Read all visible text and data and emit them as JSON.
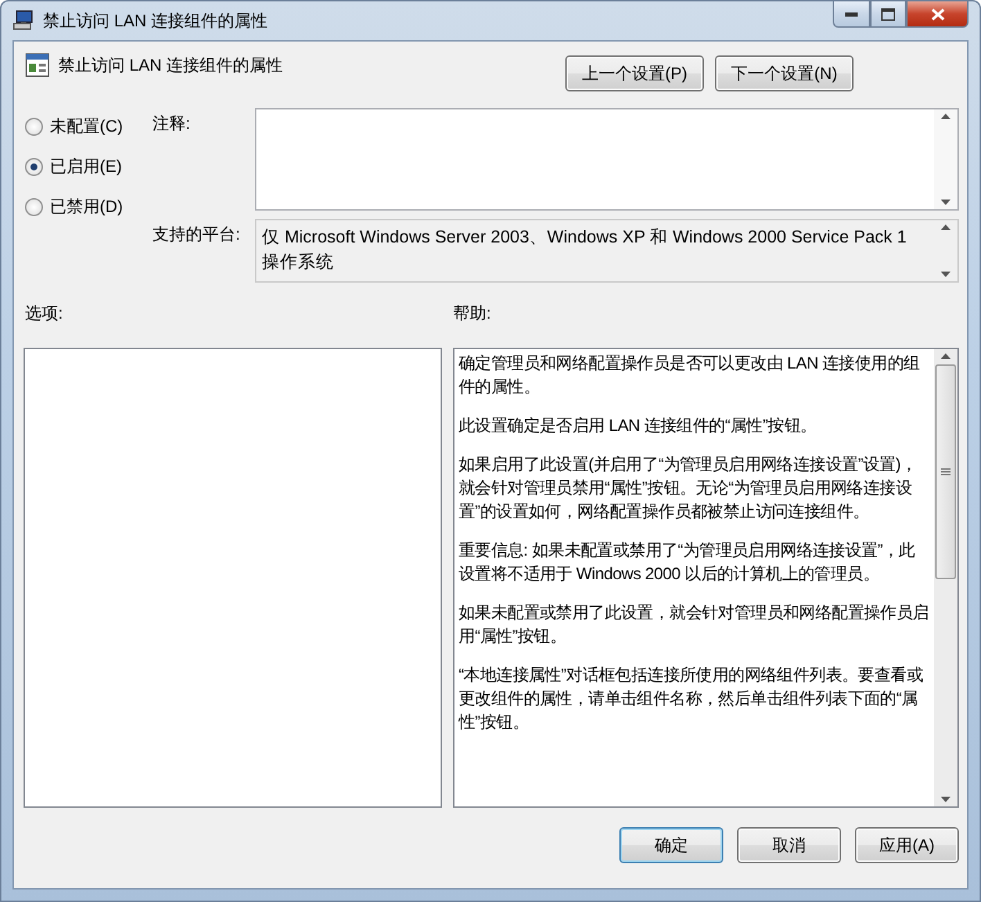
{
  "window": {
    "title": "禁止访问 LAN 连接组件的属性"
  },
  "header": {
    "title": "禁止访问 LAN 连接组件的属性",
    "buttons": [
      "上一个设置(P)",
      "下一个设置(N)"
    ]
  },
  "state_options": [
    {
      "label": "未配置(C)",
      "selected": false
    },
    {
      "label": "已启用(E)",
      "selected": true
    },
    {
      "label": "已禁用(D)",
      "selected": false
    }
  ],
  "comment": {
    "label": "注释:"
  },
  "platform": {
    "label": "支持的平台:",
    "value": "仅 Microsoft Windows Server 2003、Windows XP 和 Windows 2000 Service Pack 1 操作系统"
  },
  "options": {
    "label": "选项:"
  },
  "help": {
    "label": "帮助:",
    "paragraphs": [
      "确定管理员和网络配置操作员是否可以更改由 LAN 连接使用的组件的属性。",
      "此设置确定是否启用 LAN 连接组件的“属性”按钮。",
      "如果启用了此设置(并启用了“为管理员启用网络连接设置”设置)，就会针对管理员禁用“属性”按钮。无论“为管理员启用网络连接设置”的设置如何，网络配置操作员都被禁止访问连接组件。",
      "重要信息: 如果未配置或禁用了“为管理员启用网络连接设置”，此设置将不适用于 Windows 2000 以后的计算机上的管理员。",
      "如果未配置或禁用了此设置，就会针对管理员和网络配置操作员启用“属性”按钮。",
      "“本地连接属性”对话框包括连接所使用的网络组件列表。要查看或更改组件的属性，请单击组件名称，然后单击组件列表下面的“属性”按钮。"
    ]
  },
  "buttons": [
    {
      "label": "确定",
      "default": true
    },
    {
      "label": "取消",
      "default": false
    },
    {
      "label": "应用(A)",
      "default": false
    }
  ]
}
